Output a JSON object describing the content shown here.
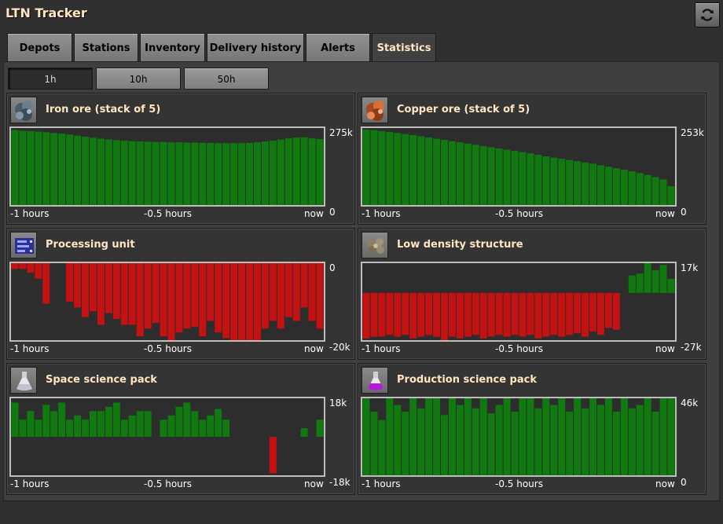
{
  "app": {
    "title": "LTN Tracker",
    "refresh_icon": "refresh-icon"
  },
  "tabs": [
    {
      "label": "Depots",
      "active": false
    },
    {
      "label": "Stations",
      "active": false
    },
    {
      "label": "Inventory",
      "active": false
    },
    {
      "label": "Delivery history",
      "active": false
    },
    {
      "label": "Alerts",
      "active": false
    },
    {
      "label": "Statistics",
      "active": true
    }
  ],
  "periods": [
    {
      "label": "1h",
      "active": true
    },
    {
      "label": "10h",
      "active": false
    },
    {
      "label": "50h",
      "active": false
    }
  ],
  "colors": {
    "positive": "#107a10",
    "negative": "#c41212",
    "chart_bg": "#2d2d2d",
    "title": "#ffe6c0"
  },
  "x_labels": [
    "-1 hours",
    "-0.5 hours",
    "now"
  ],
  "chart_data": [
    {
      "type": "bar",
      "title": "Iron ore (stack of 5)",
      "icon": "iron-ore-icon",
      "ylim": [
        0,
        275
      ],
      "y_max_label": "275k",
      "y_min_label": "0",
      "values": [
        268,
        265,
        264,
        262,
        260,
        257,
        255,
        252,
        248,
        244,
        240,
        237,
        234,
        232,
        230,
        228,
        227,
        226,
        225,
        225,
        224,
        224,
        223,
        223,
        222,
        222,
        221,
        221,
        221,
        221,
        222,
        224,
        227,
        230,
        234,
        238,
        241,
        242,
        238,
        236
      ]
    },
    {
      "type": "bar",
      "title": "Copper ore (stack of 5)",
      "icon": "copper-ore-icon",
      "ylim": [
        0,
        253
      ],
      "y_max_label": "253k",
      "y_min_label": "0",
      "values": [
        248,
        246,
        243,
        240,
        237,
        233,
        230,
        226,
        222,
        218,
        214,
        210,
        206,
        202,
        198,
        194,
        190,
        186,
        182,
        178,
        174,
        170,
        165,
        160,
        156,
        152,
        148,
        144,
        140,
        136,
        131,
        126,
        121,
        116,
        111,
        105,
        99,
        92,
        84,
        62
      ]
    },
    {
      "type": "bar",
      "title": "Processing unit",
      "icon": "processing-unit-icon",
      "ylim": [
        -20,
        0
      ],
      "y_max_label": "0",
      "y_min_label": "-20k",
      "values": [
        -1.5,
        -1.5,
        -2.5,
        -4,
        -10.5,
        0,
        0,
        -10,
        -11.5,
        -14,
        -12.5,
        -16,
        -13,
        -14.5,
        -16,
        -16,
        -19,
        -17,
        -15.5,
        -19,
        -20,
        -18,
        -17,
        -16.5,
        -19,
        -15,
        -18,
        -19.5,
        -20,
        -20,
        -20,
        -20,
        -17,
        -15,
        -17,
        -14,
        -15,
        -11.5,
        -15,
        -17
      ]
    },
    {
      "type": "bar",
      "title": "Low density structure",
      "icon": "low-density-structure-icon",
      "ylim": [
        -27,
        17
      ],
      "y_max_label": "17k",
      "y_min_label": "-27k",
      "values": [
        -26,
        -25,
        -25,
        -24,
        -25,
        -24,
        -26,
        -25,
        -24,
        -25,
        -27,
        -25,
        -26,
        -25,
        -24,
        -26,
        -25,
        -24,
        -25,
        -24,
        -25,
        -24,
        -26,
        -25,
        -24,
        -25,
        -24,
        -23,
        -25,
        -22,
        -24,
        -20,
        -21,
        0,
        10,
        11,
        17,
        13,
        16,
        8
      ]
    },
    {
      "type": "bar",
      "title": "Space science pack",
      "icon": "space-science-pack-icon",
      "ylim": [
        -18,
        18
      ],
      "y_max_label": "18k",
      "y_min_label": "-18k",
      "values": [
        16,
        8,
        12,
        8,
        15,
        12,
        16,
        8,
        10,
        8,
        12,
        12,
        14,
        16,
        8,
        10,
        12,
        12,
        0,
        8,
        10,
        14,
        16,
        12,
        8,
        10,
        13,
        8,
        0,
        0,
        0,
        0,
        0,
        -17,
        0,
        0,
        0,
        4,
        0,
        8
      ]
    },
    {
      "type": "bar",
      "title": "Production science pack",
      "icon": "production-science-pack-icon",
      "ylim": [
        0,
        46
      ],
      "y_max_label": "46k",
      "y_min_label": "0",
      "values": [
        46,
        38,
        33,
        46,
        42,
        38,
        46,
        40,
        46,
        46,
        36,
        46,
        42,
        46,
        40,
        46,
        37,
        42,
        46,
        38,
        46,
        46,
        40,
        46,
        42,
        46,
        38,
        46,
        40,
        46,
        42,
        46,
        38,
        46,
        40,
        42,
        46,
        38,
        46,
        46
      ]
    }
  ]
}
